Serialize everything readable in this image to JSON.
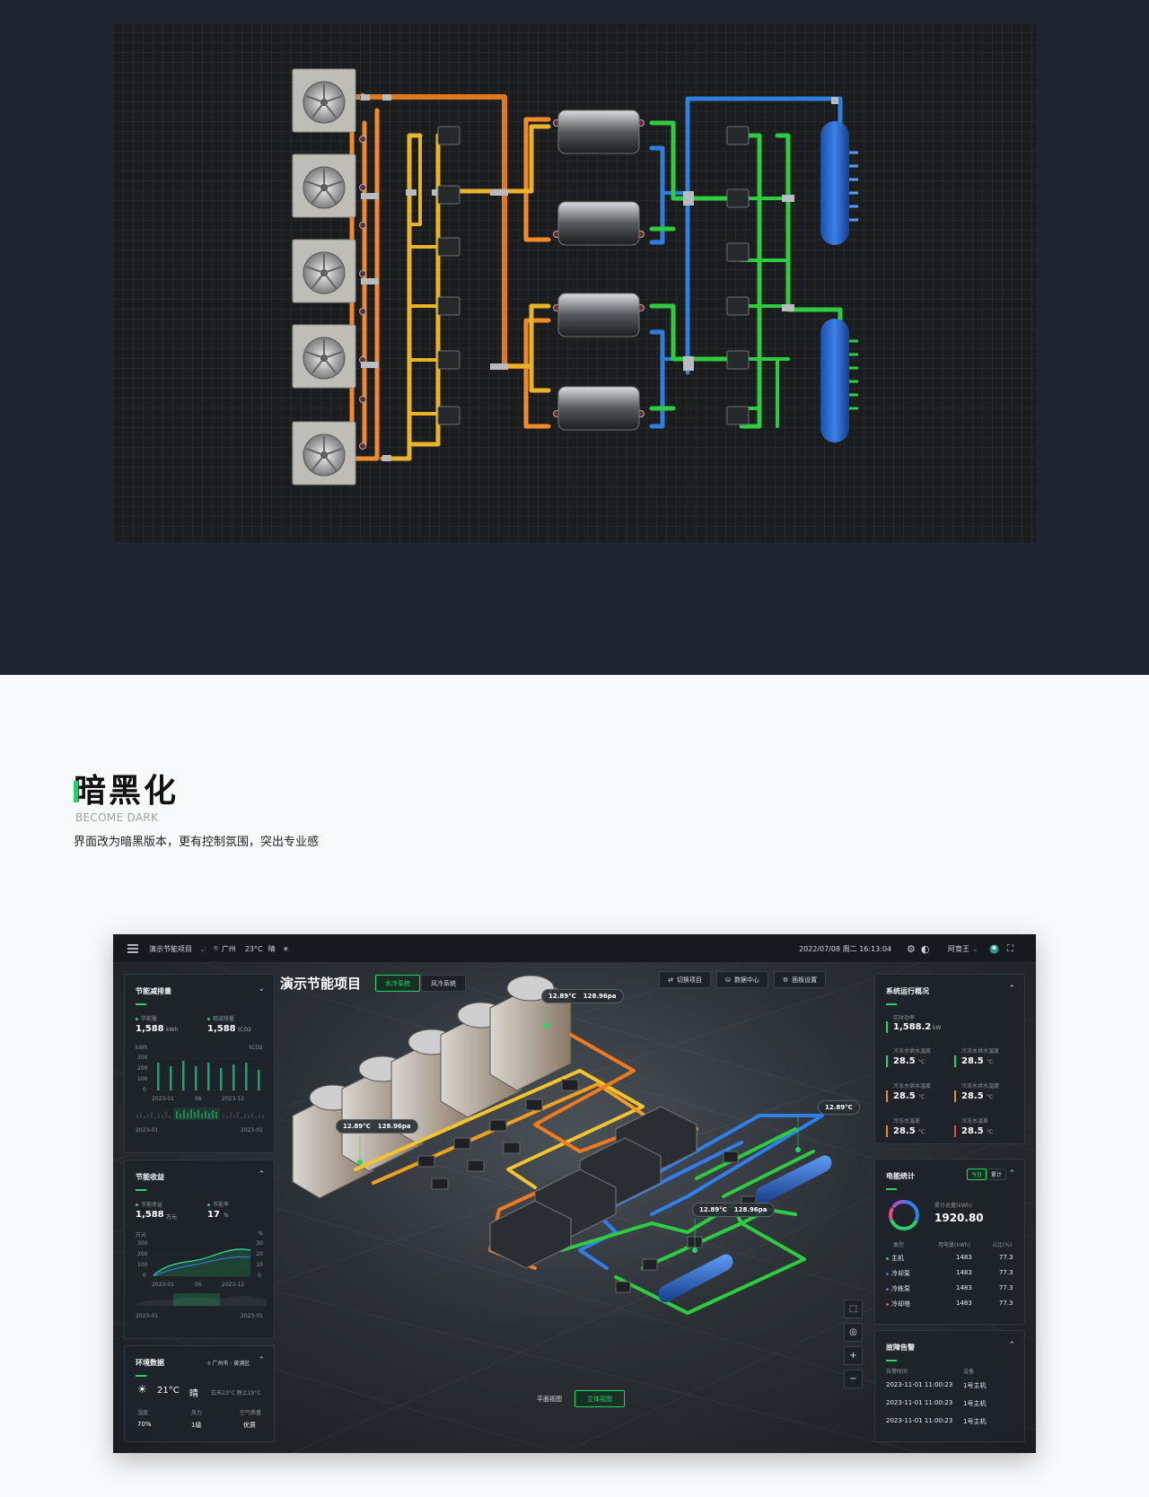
{
  "section": {
    "title": "暗黑化",
    "subtitle": "BECOME DARK",
    "description": "界面改为暗黑版本，更有控制氛围，突出专业感"
  },
  "colors": {
    "accent": "#27d46a",
    "pipe_orange": "#f08a2c",
    "pipe_yellow": "#e8b52a",
    "pipe_blue": "#2f7fe0",
    "pipe_green": "#2ecc40"
  },
  "topbar": {
    "menu_icon": "menu-icon",
    "project": "演示节能项目",
    "city": "广州",
    "temperature": "23°C",
    "weather": "晴",
    "datetime": "2022/07/08  周二  16:13:04",
    "user": "阿育王"
  },
  "scene": {
    "title": "演示节能项目",
    "tabs": [
      "水冷系统",
      "风冷系统"
    ],
    "actions": [
      "切换项目",
      "数据中心",
      "面板设置"
    ],
    "view_tabs": [
      "平面视图",
      "立体视图"
    ],
    "tags": [
      {
        "temp": "12.89°C",
        "pressure": "128.96pa"
      },
      {
        "temp": "12.89°C",
        "pressure": "128.96pa"
      },
      {
        "temp": "12.89°C",
        "pressure": "128.96pa"
      },
      {
        "temp": "12.89°C",
        "pressure": ""
      }
    ],
    "tools": [
      "+",
      "−"
    ]
  },
  "energy_saving": {
    "title": "节能减排量",
    "items": [
      {
        "label": "节能量",
        "value": "1,588",
        "unit": "kWh"
      },
      {
        "label": "碳减排量",
        "value": "1,588",
        "unit": "tCO2"
      }
    ],
    "left_unit": "kWh",
    "right_unit": "tCO2",
    "yticks": [
      "300",
      "200",
      "100",
      "0"
    ],
    "xticks": [
      "2023-01",
      "06",
      "2023-12"
    ],
    "range_start": "2023-01",
    "range_end": "2023-01"
  },
  "revenue": {
    "title": "节能收益",
    "items": [
      {
        "label": "节能收益",
        "value": "1,588",
        "unit": "万元"
      },
      {
        "label": "节能率",
        "value": "17",
        "unit": "%"
      }
    ],
    "left_unit": "万元",
    "right_unit": "%",
    "yticks": [
      "300",
      "200",
      "100",
      "0"
    ],
    "yticks_right": [
      "30",
      "20",
      "10",
      "0"
    ],
    "xticks": [
      "2023-01",
      "06",
      "2023-12"
    ],
    "range_start": "2023-01",
    "range_end": "2023-01"
  },
  "environment": {
    "title": "环境数据",
    "location": "广州市 · 黄浦区",
    "temp": "21°C",
    "weather": "晴",
    "range": "白天23°C  晚上19°C",
    "stats": [
      {
        "label": "湿度",
        "value": "70%"
      },
      {
        "label": "风力",
        "value": "1级"
      },
      {
        "label": "空气质量",
        "value": "优质"
      }
    ]
  },
  "system": {
    "title": "系统运行概况",
    "power_label": "实时功率",
    "power_value": "1,588.2",
    "power_unit": "kW",
    "metrics": [
      {
        "label": "冷冻水供水温度",
        "value": "28.5",
        "unit": "°C"
      },
      {
        "label": "冷冻水供水温度",
        "value": "28.5",
        "unit": "°C"
      },
      {
        "label": "冷冻水供水温度",
        "value": "28.5",
        "unit": "°C"
      },
      {
        "label": "冷冻水供水温度",
        "value": "28.5",
        "unit": "°C"
      },
      {
        "label": "冷冻水温差",
        "value": "28.5",
        "unit": "°C"
      },
      {
        "label": "冷冻水温差",
        "value": "28.5",
        "unit": "°C"
      }
    ]
  },
  "energy_stats": {
    "title": "电能统计",
    "toggle": [
      "今日",
      "累计"
    ],
    "total_label": "累计总量(kWh)",
    "total_value": "1920.80",
    "headers": [
      "类型",
      "用电量(kWh)",
      "占比(%)"
    ],
    "rows": [
      {
        "name": "主机",
        "value": "1483",
        "pct": "77.3",
        "color": "#2ecc71"
      },
      {
        "name": "冷却泵",
        "value": "1483",
        "pct": "77.3",
        "color": "#2f80ed"
      },
      {
        "name": "冷栋泵",
        "value": "1483",
        "pct": "77.3",
        "color": "#9b59d6"
      },
      {
        "name": "冷却塔",
        "value": "1483",
        "pct": "77.3",
        "color": "#e84a7f"
      }
    ]
  },
  "alarms": {
    "title": "故障告警",
    "headers": [
      "告警时间",
      "设备"
    ],
    "rows": [
      {
        "time": "2023-11-01 11:00:23",
        "device": "1号主机"
      },
      {
        "time": "2023-11-01 11:00:23",
        "device": "1号主机"
      },
      {
        "time": "2023-11-01 11:00:23",
        "device": "1号主机"
      }
    ]
  }
}
